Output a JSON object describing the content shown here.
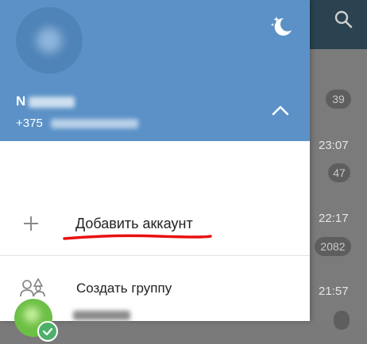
{
  "drawer": {
    "user_name": "N",
    "user_phone": "+375",
    "add_account_label": "Добавить аккаунт",
    "create_group_label": "Создать группу"
  },
  "chat_list": {
    "badges": [
      "39",
      "47",
      "2082"
    ],
    "times": [
      "23:07",
      "22:17",
      "21:57"
    ]
  },
  "icons": {
    "search": "search-icon",
    "night_mode": "moon-icon",
    "collapse": "chevron-up-icon",
    "add": "plus-icon",
    "group": "group-icon",
    "verified": "check-icon"
  },
  "colors": {
    "header": "#5b91c7",
    "accent_green": "#6cc045",
    "underline_red": "#e81010",
    "topbar": "#2b4250"
  }
}
